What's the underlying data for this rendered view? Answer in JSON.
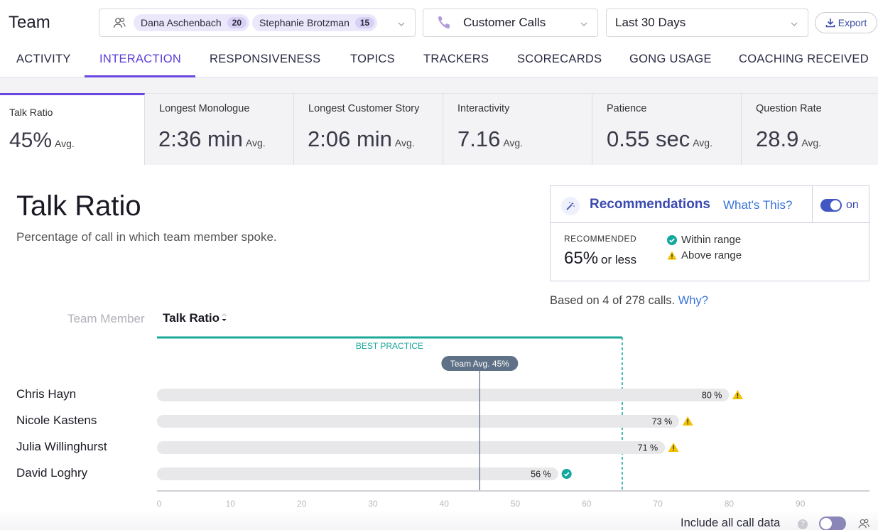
{
  "header": {
    "title": "Team",
    "members": [
      {
        "name": "Dana Aschenbach",
        "count": "20"
      },
      {
        "name": "Stephanie Brotzman",
        "count": "15"
      }
    ],
    "call_type": "Customer Calls",
    "date_range": "Last 30 Days",
    "export_label": "Export"
  },
  "tabs": [
    {
      "label": "ACTIVITY"
    },
    {
      "label": "INTERACTION"
    },
    {
      "label": "RESPONSIVENESS"
    },
    {
      "label": "TOPICS"
    },
    {
      "label": "TRACKERS"
    },
    {
      "label": "SCORECARDS"
    },
    {
      "label": "GONG USAGE"
    },
    {
      "label": "COACHING RECEIVED"
    }
  ],
  "active_tab": "INTERACTION",
  "metrics": [
    {
      "label": "Talk Ratio",
      "value": "45%",
      "suffix": "Avg."
    },
    {
      "label": "Longest Monologue",
      "value": "2:36 min",
      "suffix": "Avg."
    },
    {
      "label": "Longest Customer Story",
      "value": "2:06 min",
      "suffix": "Avg."
    },
    {
      "label": "Interactivity",
      "value": "7.16",
      "suffix": "Avg."
    },
    {
      "label": "Patience",
      "value": "0.55 sec",
      "suffix": "Avg."
    },
    {
      "label": "Question Rate",
      "value": "28.9",
      "suffix": "Avg."
    }
  ],
  "section": {
    "title": "Talk Ratio",
    "subtitle": "Percentage of call in which team member spoke."
  },
  "recommendations": {
    "title": "Recommendations",
    "link": "What's This?",
    "toggle_label": "on",
    "recommended_label": "RECOMMENDED",
    "recommended_value": "65%",
    "recommended_unit": "or less",
    "within_label": "Within range",
    "above_label": "Above range",
    "based_on": "Based on 4 of 278 calls.",
    "why_link": "Why?"
  },
  "table_header": {
    "member_col": "Team Member",
    "ratio_col": "Talk Ratio"
  },
  "colors": {
    "accent": "#6b46e0",
    "best_practice": "#1aa89a",
    "warning": "#f2c200",
    "ok": "#13a89e",
    "bar": "#e8e8ea"
  },
  "chart_data": {
    "type": "bar",
    "orientation": "horizontal",
    "categories": [
      "Chris Hayn",
      "Nicole Kastens",
      "Julia Willinghurst",
      "David Loghry"
    ],
    "values": [
      80,
      73,
      71,
      56
    ],
    "value_suffix": " %",
    "status": [
      "above",
      "above",
      "above",
      "within"
    ],
    "xlim": [
      0,
      100
    ],
    "xticks": [
      0,
      10,
      20,
      30,
      40,
      50,
      60,
      70,
      80,
      90
    ],
    "team_avg": 45,
    "team_avg_label": "Team Avg. 45%",
    "best_practice_max": 65,
    "best_practice_label": "BEST PRACTICE",
    "grid": false
  },
  "footer": {
    "include_label": "Include all call data"
  }
}
